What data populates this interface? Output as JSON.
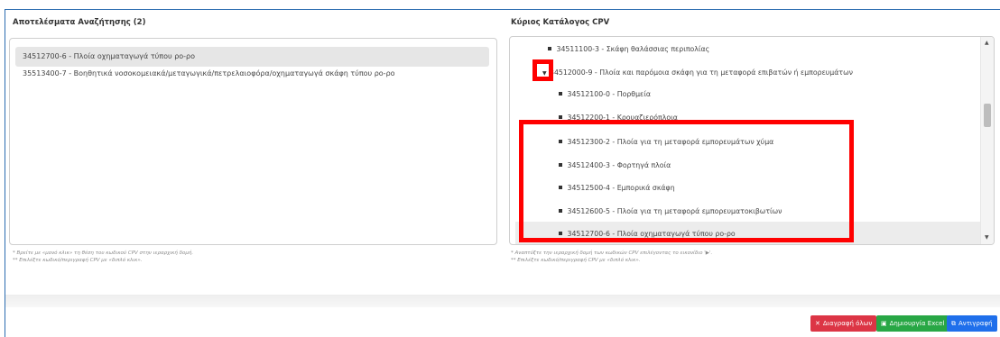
{
  "left_panel": {
    "title": "Αποτελέσματα Αναζήτησης (2)",
    "results": [
      "34512700-6 - Πλοία οχηματαγωγά τύπου ρο-ρο",
      "35513400-7 - Βοηθητικά νοσοκομειακά/μεταγωγικά/πετρελαιοφόρα/οχηματαγωγά σκάφη τύπου ρο-ρο"
    ],
    "hints": [
      "* Βρείτε με «μονό κλικ» τη θέση του κωδικού CPV στην ιεραρχική δομή.",
      "** Επιλέξτε κωδικό/περιγραφή CPV με «διπλό κλικ»."
    ]
  },
  "right_panel": {
    "title": "Κύριος Κατάλογος CPV",
    "tree": [
      "34511100-3 - Σκάφη θαλάσσιας περιπολίας",
      "34512000-9 - Πλοία και παρόμοια σκάφη για τη μεταφορά επιβατών ή εμπορευμάτων",
      "34512100-0 - Πορθμεία",
      "34512200-1 - Κρουαζιερόπλοια",
      "34512300-2 - Πλοία για τη μεταφορά εμπορευμάτων χύμα",
      "34512400-3 - Φορτηγά πλοία",
      "34512500-4 - Εμπορικά σκάφη",
      "34512600-5 - Πλοία για τη μεταφορά εμπορευματοκιβωτίων",
      "34512700-6 - Πλοία οχηματαγωγά τύπου ρο-ρο"
    ],
    "hints": [
      "* Αναπτύξτε την ιεραρχική δομή των κωδικών CPV επιλέγοντας το εικονίδιο '▶'.",
      "** Επιλέξτε κωδικό/περιγραφή CPV με «διπλό κλικ»."
    ]
  },
  "buttons": {
    "delete_all": "Διαγραφή όλων",
    "create_excel": "Δημιουργία Excel",
    "copy": "Αντιγραφή"
  },
  "colors": {
    "delete": "#dc3545",
    "excel": "#28a745",
    "copy": "#1f6feb",
    "highlight_red": "#ff0000",
    "frame_blue": "#2b6cb0"
  }
}
